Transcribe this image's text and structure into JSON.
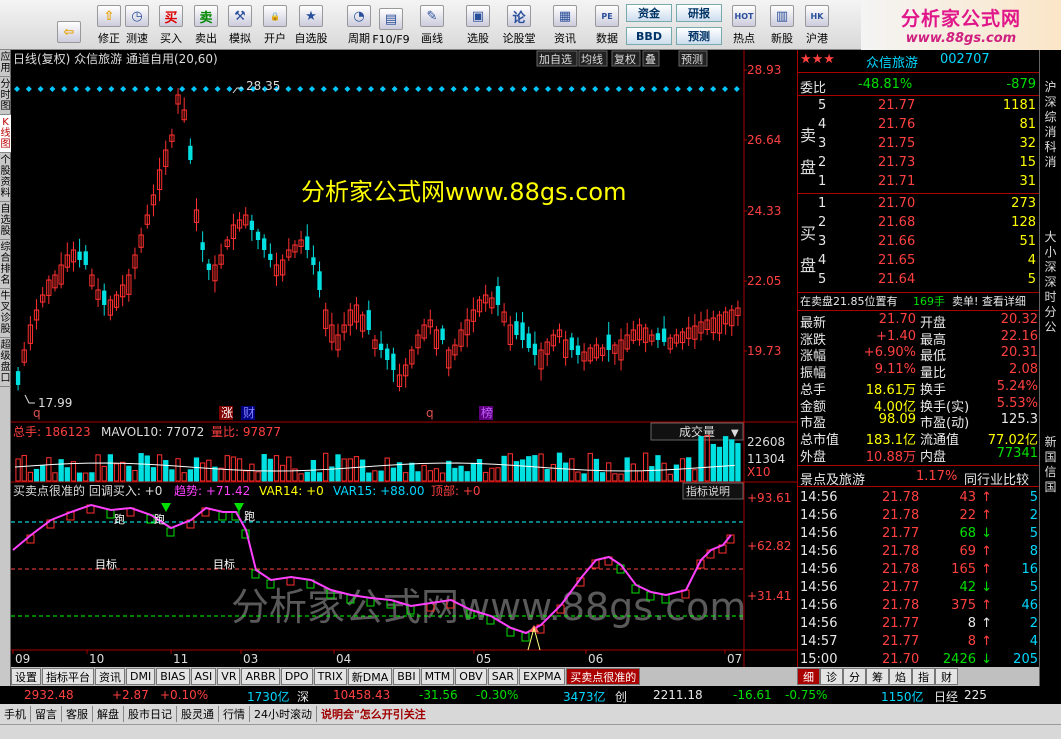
{
  "toolbar": {
    "buttons": [
      {
        "icon": "back-icon",
        "label": ""
      },
      {
        "icon": "home-icon",
        "label": "修正"
      },
      {
        "icon": "clock-icon",
        "label": "测速"
      },
      {
        "icon": "buy-icon",
        "label": "买入"
      },
      {
        "icon": "sell-icon",
        "label": "卖出"
      },
      {
        "icon": "hammer-icon",
        "label": "模拟"
      },
      {
        "icon": "lock-icon",
        "label": "开户"
      },
      {
        "icon": "star-icon",
        "label": "自选股"
      },
      {
        "icon": "period-icon",
        "label": "周期"
      },
      {
        "icon": "f10-icon",
        "label": "F10/F9"
      },
      {
        "icon": "pen-icon",
        "label": "画线"
      },
      {
        "icon": "chart-icon",
        "label": "选股"
      },
      {
        "icon": "forum-icon",
        "label": "论股堂"
      },
      {
        "icon": "news-icon",
        "label": "资讯"
      },
      {
        "icon": "pe-icon",
        "label": "数据"
      },
      {
        "icon": "hot-icon",
        "label": "热点"
      },
      {
        "icon": "newstock-icon",
        "label": "新股"
      },
      {
        "icon": "hk-icon",
        "label": "沪港"
      }
    ],
    "small_buttons": [
      "资金",
      "BBD",
      "研报",
      "预测"
    ],
    "buy_glyph": "买",
    "sell_glyph": "卖"
  },
  "logo": {
    "line1": "分析家公式网",
    "line2": "www.88gs.com"
  },
  "left_tabs": [
    "应用",
    "分时图",
    "K线图",
    "个股资料",
    "自选股",
    "综合排名",
    "牛叉诊股",
    "超级盘口"
  ],
  "chart": {
    "header": "日线(复权)  众信旅游  通道自用(20,60)",
    "header_buttons": [
      "加自选",
      "均线",
      "复权",
      "叠",
      "预测"
    ],
    "price_axis": [
      "28.93",
      "26.64",
      "24.33",
      "22.05",
      "19.73"
    ],
    "high_label": "28.35",
    "low_label": "17.99",
    "watermark": "分析家公式网www.88gs.com",
    "watermark2": "分析家公式网www.88gs.com",
    "markers": [
      "q",
      "涨",
      "财",
      "q",
      "榜"
    ],
    "volume_header": {
      "total": "总手: 186123",
      "mavol": "MAVOL10: 77072",
      "ratio": "量比: 97877"
    },
    "volume_dropdown": "成交量",
    "volume_axis": [
      "22608",
      "11304",
      "X10"
    ],
    "indicator_header": {
      "name": "买卖点很准的 回调买入: +0",
      "trend": "趋势: +71.42",
      "var14": "VAR14: +0",
      "var15": "VAR15: +88.00",
      "top": "顶部: +0"
    },
    "indicator_button": "指标说明",
    "indicator_axis": [
      "+93.61",
      "+62.82",
      "+31.41"
    ],
    "indicator_labels": [
      "跑",
      "跑",
      "跑",
      "目标",
      "目标"
    ],
    "date_axis": [
      "09",
      "10",
      "11",
      "03",
      "04",
      "05",
      "06",
      "07"
    ]
  },
  "bottom_tabs": [
    "设置",
    "指标平台",
    "资讯",
    "DMI",
    "BIAS",
    "ASI",
    "VR",
    "ARBR",
    "DPO",
    "TRIX",
    "新DMA",
    "BBI",
    "MTM",
    "OBV",
    "SAR",
    "EXPMA",
    "买卖点很准的"
  ],
  "right_panel": {
    "stars": "★★★",
    "stock_name": "众信旅游",
    "stock_code": "002707",
    "weibi": {
      "label": "委比",
      "pct": "-48.81%",
      "diff": "-879"
    },
    "sell_label": [
      "卖",
      "盘"
    ],
    "buy_label": [
      "买",
      "盘"
    ],
    "sells": [
      {
        "n": "5",
        "price": "21.77",
        "vol": "1181"
      },
      {
        "n": "4",
        "price": "21.76",
        "vol": "81"
      },
      {
        "n": "3",
        "price": "21.75",
        "vol": "32"
      },
      {
        "n": "2",
        "price": "21.73",
        "vol": "15"
      },
      {
        "n": "1",
        "price": "21.71",
        "vol": "31"
      }
    ],
    "buys": [
      {
        "n": "1",
        "price": "21.70",
        "vol": "273"
      },
      {
        "n": "2",
        "price": "21.68",
        "vol": "128"
      },
      {
        "n": "3",
        "price": "21.66",
        "vol": "51"
      },
      {
        "n": "4",
        "price": "21.65",
        "vol": "4"
      },
      {
        "n": "5",
        "price": "21.64",
        "vol": "5"
      }
    ],
    "order_info": {
      "text": "在卖盘21.85位置有",
      "qty": "169手",
      "tail": "卖单! 查看详细"
    },
    "quote": [
      {
        "l1": "最新",
        "v1": "21.70",
        "l2": "开盘",
        "v2": "20.32"
      },
      {
        "l1": "涨跌",
        "v1": "+1.40",
        "l2": "最高",
        "v2": "22.16"
      },
      {
        "l1": "涨幅",
        "v1": "+6.90%",
        "l2": "最低",
        "v2": "20.31"
      },
      {
        "l1": "振幅",
        "v1": "9.11%",
        "l2": "量比",
        "v2": "2.08"
      },
      {
        "l1": "总手",
        "v1": "18.61万",
        "l2": "换手",
        "v2": "5.24%"
      },
      {
        "l1": "金额",
        "v1": "4.00亿",
        "l2": "换手(实)",
        "v2": "5.53%"
      },
      {
        "l1": "市盈",
        "v1": "98.09",
        "l2": "市盈(动)",
        "v2": "125.3"
      },
      {
        "l1": "总市值",
        "v1": "183.1亿",
        "l2": "流通值",
        "v2": "77.02亿"
      },
      {
        "l1": "外盘",
        "v1": "10.88万",
        "l2": "内盘",
        "v2": "77341"
      }
    ],
    "sector": {
      "name": "景点及旅游",
      "pct": "1.17%",
      "compare": "同行业比较"
    },
    "ticks": [
      {
        "time": "14:56",
        "price": "21.78",
        "vol": "43",
        "dir": "up",
        "n": "5"
      },
      {
        "time": "14:56",
        "price": "21.78",
        "vol": "22",
        "dir": "up",
        "n": "2"
      },
      {
        "time": "14:56",
        "price": "21.77",
        "vol": "68",
        "dir": "down",
        "n": "5"
      },
      {
        "time": "14:56",
        "price": "21.78",
        "vol": "69",
        "dir": "up",
        "n": "8"
      },
      {
        "time": "14:56",
        "price": "21.78",
        "vol": "165",
        "dir": "up",
        "n": "16"
      },
      {
        "time": "14:56",
        "price": "21.77",
        "vol": "42",
        "dir": "down",
        "n": "5"
      },
      {
        "time": "14:56",
        "price": "21.78",
        "vol": "375",
        "dir": "up",
        "n": "46"
      },
      {
        "time": "14:56",
        "price": "21.77",
        "vol": "8",
        "dir": "flat",
        "n": "2"
      },
      {
        "time": "14:57",
        "price": "21.77",
        "vol": "8",
        "dir": "up",
        "n": "4"
      },
      {
        "time": "15:00",
        "price": "21.70",
        "vol": "2426",
        "dir": "down",
        "n": "205"
      }
    ],
    "tabs": [
      "细",
      "诊",
      "分",
      "筹",
      "焰",
      "指",
      "财"
    ]
  },
  "right_edge": [
    "沪",
    "深",
    "综",
    "消",
    "科",
    "消",
    "大",
    "小",
    "深",
    "深",
    "时",
    "分",
    "公",
    "新",
    "国",
    "信",
    "国"
  ],
  "status1": {
    "idx1": "2932.48",
    "chg1": "+2.87",
    "pct1": "+0.10%",
    "amt1": "1730亿",
    "name2": "深",
    "idx2": "10458.43",
    "chg2": "-31.56",
    "pct2": "-0.30%",
    "amt2": "3473亿",
    "name3": "创",
    "idx3": "2211.18",
    "chg3": "-16.61",
    "pct3": "-0.75%",
    "amt3": "1150亿",
    "name4": "日经",
    "idx4": "225"
  },
  "status2": [
    "手机",
    "留言",
    "客服",
    "解盘",
    "股市日记",
    "股灵通",
    "行情",
    "24小时滚动"
  ],
  "status2_news": "说明会\"怎么开引关注"
}
